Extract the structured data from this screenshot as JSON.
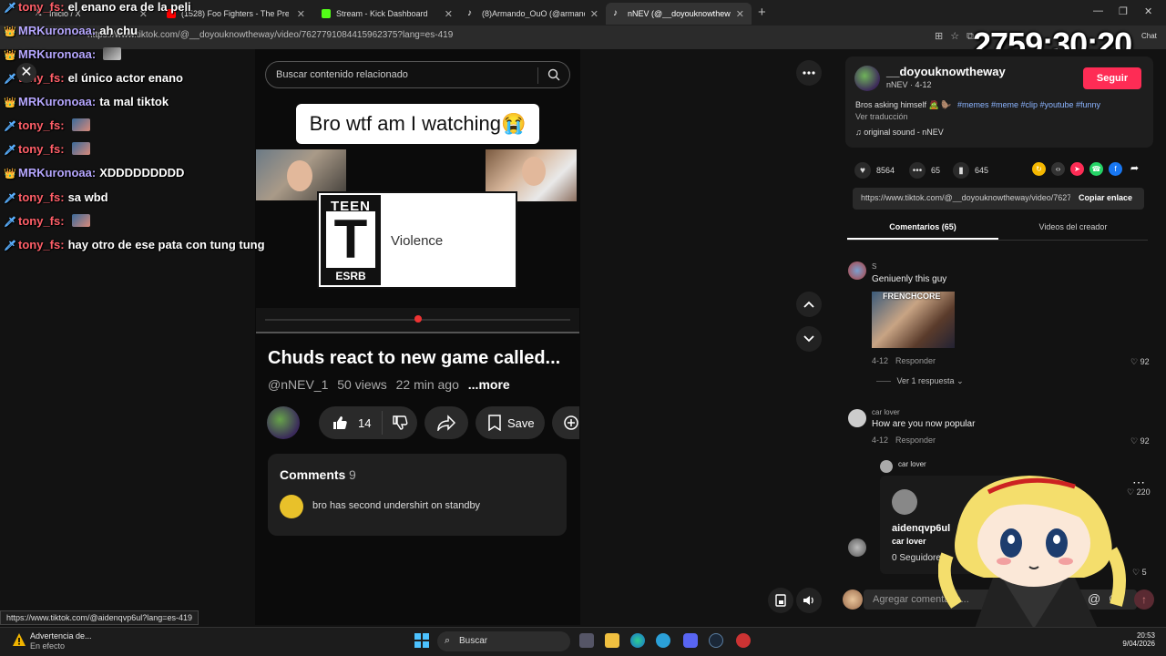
{
  "tabs": [
    {
      "title": "Inicio / X"
    },
    {
      "title": "(1528) Foo Fighters - The Pretender"
    },
    {
      "title": "Stream - Kick Dashboard"
    },
    {
      "title": "(8)Armando_OuO (@armando_ouo)"
    },
    {
      "title": "nNEV (@__doyouknowtheway)"
    }
  ],
  "address_url": "https://www.tiktok.com/@__doyouknowtheway/video/7627791084415962375?lang=es-419",
  "timer": "2759:30:20",
  "chat_label": "Chat",
  "chat": [
    {
      "user": "tony_fs:",
      "kind": "u2",
      "text": "el enano era de la peli",
      "emote": false
    },
    {
      "user": "MRKuronoaa:",
      "kind": "u1",
      "text": "ah chu",
      "emote": false
    },
    {
      "user": "MRKuronoaa:",
      "kind": "u1",
      "text": "",
      "emote": true
    },
    {
      "user": "tony_fs:",
      "kind": "u2",
      "text": "el único actor enano",
      "emote": false
    },
    {
      "user": "MRKuronoaa:",
      "kind": "u1",
      "text": "ta mal tiktok",
      "emote": false
    },
    {
      "user": "tony_fs:",
      "kind": "u2",
      "text": "",
      "emote": true
    },
    {
      "user": "tony_fs:",
      "kind": "u2",
      "text": "",
      "emote": true
    },
    {
      "user": "MRKuronoaa:",
      "kind": "u1",
      "text": "XDDDDDDDDD",
      "emote": false
    },
    {
      "user": "tony_fs:",
      "kind": "u2",
      "text": "sa wbd",
      "emote": false
    },
    {
      "user": "tony_fs:",
      "kind": "u2",
      "text": "",
      "emote": true
    },
    {
      "user": "tony_fs:",
      "kind": "u2",
      "text": "hay otro de ese pata con tung tung",
      "emote": false
    }
  ],
  "yt": {
    "search_placeholder": "Buscar contenido relacionado",
    "caption": "Bro wtf am I watching😭",
    "esrb_teen": "TEEN",
    "esrb_letter": "T",
    "esrb_label": "ESRB",
    "esrb_descriptor": "Violence",
    "title": "Chuds react to new game called...",
    "channel": "@nNEV_1",
    "views": "50 views",
    "age": "22 min ago",
    "more": "...more",
    "likes": "14",
    "save": "Save",
    "comments_label": "Comments",
    "comments_count": "9",
    "top_comment": "bro has second undershirt on standby"
  },
  "tiktok": {
    "username": "__doyouknowtheway",
    "subline": "nNEV · 4-12",
    "follow": "Seguir",
    "description": "Bros asking himself 🧟 🦫",
    "hashtags": "#memes #meme #clip #youtube #funny",
    "translate": "Ver traducción",
    "sound": "♫  original sound - nNEV",
    "likes": "8564",
    "comments": "65",
    "saves": "645",
    "link": "https://www.tiktok.com/@__doyouknowtheway/video/7627791084415962375",
    "copy_link": "Copiar enlace",
    "tab_comments": "Comentarios (65)",
    "tab_videos": "Videos del creador",
    "comment_list": [
      {
        "name": "S",
        "text": "Geniuenly this guy",
        "date": "4-12",
        "reply": "Responder",
        "likes": "92"
      },
      {
        "name": "car lover",
        "text": "How are you now popular",
        "date": "4-12",
        "reply": "Responder",
        "likes": "92"
      }
    ],
    "view_replies": "Ver 1 respuesta",
    "thumb_label": "FRENCHCORE",
    "nested_name": "car lover",
    "nested_likes": "220",
    "last_likes": "5",
    "popup_user": "aidenqvp6ul",
    "popup_sub": "car lover",
    "popup_followers": "0 Seguidores",
    "comment_placeholder": "Agregar comentario..."
  },
  "status_url": "https://www.tiktok.com/@aidenqvp6ul?lang=es-419",
  "taskbar": {
    "warning_title": "Advertencia de...",
    "warning_sub": "En efecto",
    "search": "Buscar",
    "time": "20:53",
    "date": "9/04/2026"
  }
}
